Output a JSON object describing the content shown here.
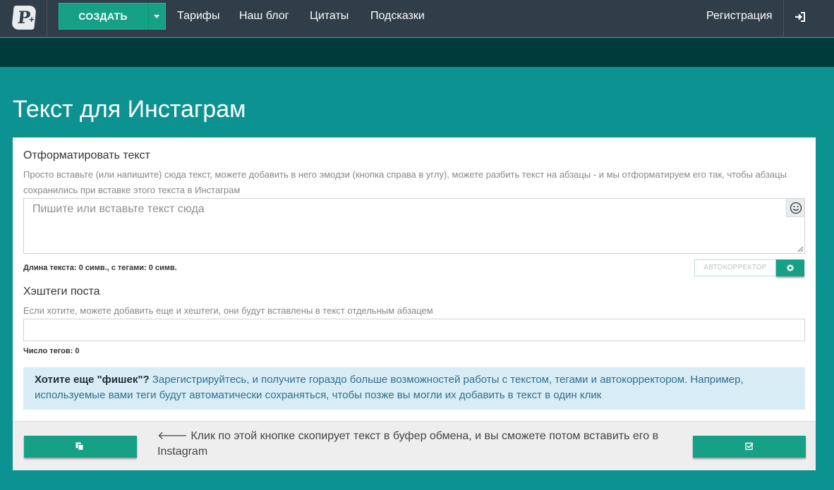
{
  "nav": {
    "logo_letter": "P",
    "logo_plus": "+",
    "create_label": "СОЗДАТЬ",
    "links": [
      "Тарифы",
      "Наш блог",
      "Цитаты",
      "Подсказки"
    ],
    "register_label": "Регистрация",
    "login_icon": "sign-in-icon"
  },
  "page": {
    "title": "Текст для Инстаграм"
  },
  "format_section": {
    "title": "Отформатировать текст",
    "hint": "Просто вставьте (или напишите) сюда текст, можете добавить в него эмодзи (кнопка справа в углу), можете разбить текст на абзацы - и мы отформатируем его так, чтобы абзацы сохранились при вставке этого текста в Инстаграм",
    "textarea_placeholder": "Пишите или вставьте текст сюда",
    "emoji_icon": "smiley-icon",
    "length_text": "Длина текста: 0 симв., с тегами: 0 симв.",
    "autocorrector_label": "АВТОКОРРЕКТОР",
    "settings_icon": "gear-icon"
  },
  "hashtags_section": {
    "title": "Хэштеги поста",
    "hint": "Если хотите, можете добавить еще и хештеги, они будут вставлены в текст отдельным абзацем",
    "input_value": "",
    "count_text": "Число тегов: 0"
  },
  "info": {
    "bold_lead": "Хотите еще \"фишек\"?",
    "text": " Зарегистрируйтесь, и получите гораздо больше возможностей работы с текстом, тегами и автокорректором. Например, используемые вами теги будут автоматически сохраняться, чтобы позже вы могли их добавить в текст в один клик"
  },
  "footer": {
    "copy_icon": "copy-icon",
    "arrow": "🡐",
    "text": " Клик по этой кнопке скопирует текст в буфер обмена, и вы сможете потом вставить его в Instagram",
    "check_icon": "check-square-icon"
  },
  "colors": {
    "navbar": "#2f3e48",
    "subbar": "#003b3c",
    "page_bg": "#0c9391",
    "accent": "#16a085",
    "info_bg": "#d8ecf5"
  }
}
